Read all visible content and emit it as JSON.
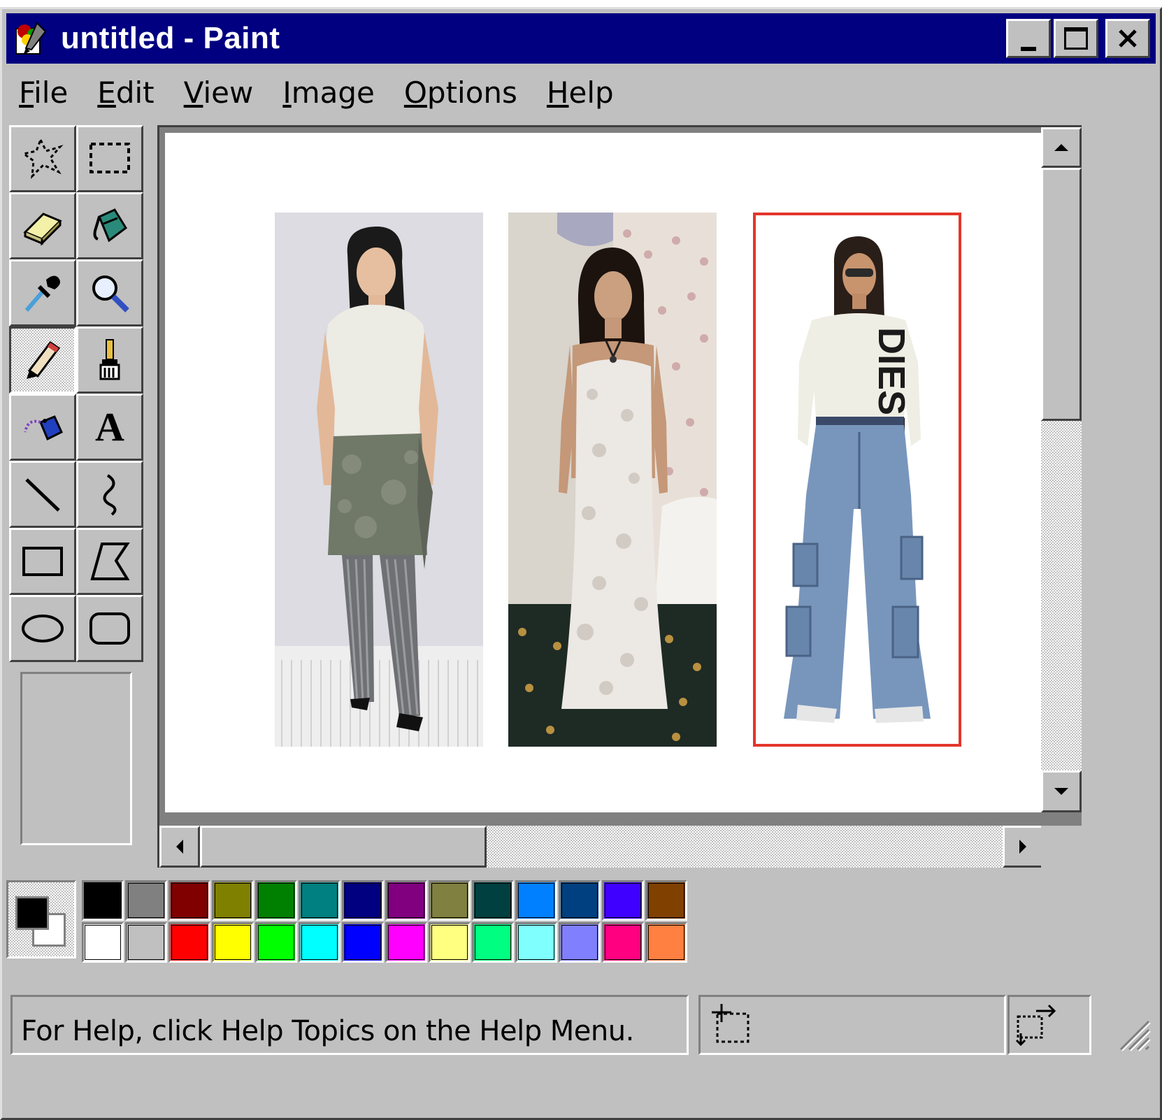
{
  "window": {
    "title": "untitled - Paint",
    "icon": "paint-app-icon",
    "controls": [
      "minimize-icon",
      "maximize-icon",
      "close-icon"
    ]
  },
  "menu": {
    "items": [
      {
        "label": "File",
        "accel": "F"
      },
      {
        "label": "Edit",
        "accel": "E"
      },
      {
        "label": "View",
        "accel": "V"
      },
      {
        "label": "Image",
        "accel": "I"
      },
      {
        "label": "Options",
        "accel": "O"
      },
      {
        "label": "Help",
        "accel": "H"
      }
    ]
  },
  "toolbox": {
    "tools": [
      "free-form-select-icon",
      "rectangle-select-icon",
      "eraser-icon",
      "fill-bucket-icon",
      "color-picker-icon",
      "magnifier-icon",
      "pencil-icon",
      "brush-icon",
      "airbrush-icon",
      "text-icon",
      "line-icon",
      "curve-icon",
      "rectangle-icon",
      "polygon-icon",
      "ellipse-icon",
      "rounded-rectangle-icon"
    ],
    "active_tool": "pencil-icon",
    "text_tool_glyph": "A"
  },
  "canvas": {
    "background": "#ffffff",
    "photos": [
      {
        "subject": "model-in-knit-top-and-skirt-over-pants",
        "selected": false
      },
      {
        "subject": "model-in-lace-slip-dress",
        "selected": false
      },
      {
        "subject": "model-in-graphic-top-and-cargo-jeans",
        "selected": true,
        "highlight_color": "#e3362b",
        "shirt_text": "DIESEL"
      }
    ]
  },
  "palette": {
    "foreground": "#000000",
    "background": "#ffffff",
    "colors_top": [
      "#000000",
      "#808080",
      "#800000",
      "#808000",
      "#008000",
      "#008080",
      "#000080",
      "#800080",
      "#808040",
      "#004040",
      "#0080ff",
      "#004080",
      "#4000ff",
      "#804000"
    ],
    "colors_bottom": [
      "#ffffff",
      "#c0c0c0",
      "#ff0000",
      "#ffff00",
      "#00ff00",
      "#00ffff",
      "#0000ff",
      "#ff00ff",
      "#ffff80",
      "#00ff80",
      "#80ffff",
      "#8080ff",
      "#ff0080",
      "#ff8040"
    ]
  },
  "status": {
    "help_text": "For Help, click Help Topics on the Help Menu."
  }
}
